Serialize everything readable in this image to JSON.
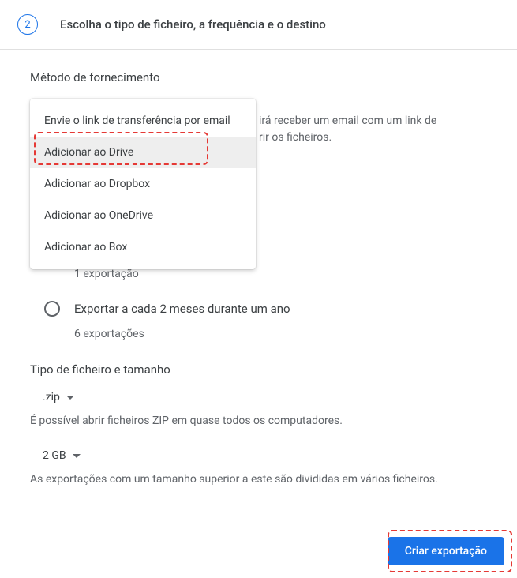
{
  "step": {
    "number": "2",
    "title": "Escolha o tipo de ficheiro, a frequência e o destino"
  },
  "delivery": {
    "title": "Método de fornecimento",
    "options": [
      "Envie o link de transferência por email",
      "Adicionar ao Drive",
      "Adicionar ao Dropbox",
      "Adicionar ao OneDrive",
      "Adicionar ao Box"
    ],
    "behind_text_1": "irá receber um email com um link de",
    "behind_text_2": "rir os ficheiros."
  },
  "frequency": {
    "option1_sub": "1 exportação",
    "option2_label": "Exportar a cada 2 meses durante um ano",
    "option2_sub": "6 exportações"
  },
  "filetype": {
    "title": "Tipo de ficheiro e tamanho",
    "zip_label": ".zip",
    "zip_helper": "É possível abrir ficheiros ZIP em quase todos os computadores.",
    "size_label": "2 GB",
    "size_helper": "As exportações com um tamanho superior a este são divididas em vários ficheiros."
  },
  "footer": {
    "create_button": "Criar exportação"
  }
}
